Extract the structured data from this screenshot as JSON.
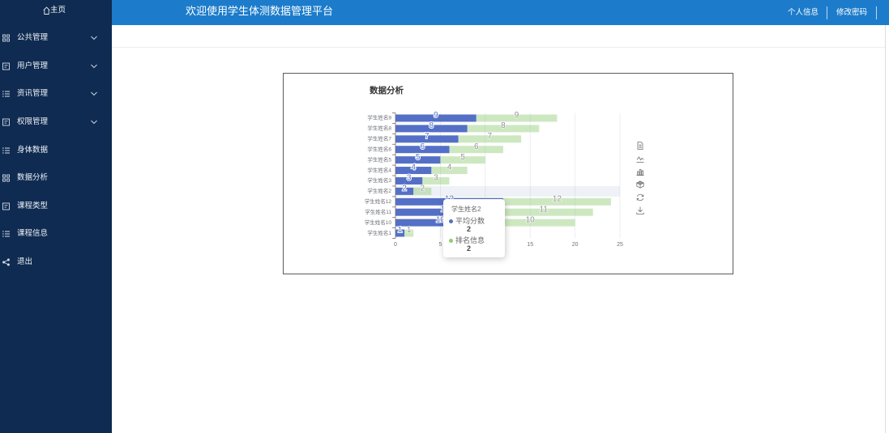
{
  "colors": {
    "sidebar_bg": "#0f2b51",
    "header_bg": "#1c7ccb"
  },
  "sidebar": {
    "home_label": "主页",
    "home_icon": "home-icon",
    "items": [
      {
        "label": "公共管理",
        "icon": "grid-icon",
        "expandable": true
      },
      {
        "label": "用户管理",
        "icon": "document-icon",
        "expandable": true
      },
      {
        "label": "资讯管理",
        "icon": "list-icon",
        "expandable": true
      },
      {
        "label": "权限管理",
        "icon": "document-icon",
        "expandable": true
      },
      {
        "label": "身体数据",
        "icon": "list-icon",
        "expandable": false
      },
      {
        "label": "数据分析",
        "icon": "grid-icon",
        "expandable": false
      },
      {
        "label": "课程类型",
        "icon": "document-icon",
        "expandable": false
      },
      {
        "label": "课程信息",
        "icon": "list-icon",
        "expandable": false
      },
      {
        "label": "退出",
        "icon": "share-icon",
        "expandable": false
      }
    ]
  },
  "header": {
    "title": "欢迎使用学生体测数据管理平台",
    "links": [
      {
        "label": "个人信息"
      },
      {
        "label": "修改密码"
      }
    ]
  },
  "chart_data": {
    "type": "bar",
    "orientation": "horizontal",
    "stacked": true,
    "title": "数据分析",
    "categories": [
      "学生姓名1",
      "学生姓名10",
      "学生姓名11",
      "学生姓名12",
      "学生姓名2",
      "学生姓名3",
      "学生姓名4",
      "学生姓名5",
      "学生姓名6",
      "学生姓名7",
      "学生姓名8",
      "学生姓名9"
    ],
    "series": [
      {
        "name": "平均分数",
        "color": "#5470c6",
        "values": [
          1,
          10,
          11,
          12,
          2,
          3,
          4,
          5,
          6,
          7,
          8,
          9
        ]
      },
      {
        "name": "排名信息",
        "color": "#91cc75",
        "values": [
          1,
          10,
          11,
          12,
          2,
          3,
          4,
          5,
          6,
          7,
          8,
          9
        ]
      }
    ],
    "xlim": [
      0,
      25
    ],
    "xticks": [
      0,
      5,
      10,
      15,
      20,
      25
    ],
    "grid": true,
    "data_labels": true,
    "tooltip": {
      "category": "学生姓名2"
    },
    "toolbox": [
      "data-view-icon",
      "line-chart-icon",
      "bar-chart-icon",
      "stack-icon",
      "restore-icon",
      "save-image-icon"
    ]
  }
}
